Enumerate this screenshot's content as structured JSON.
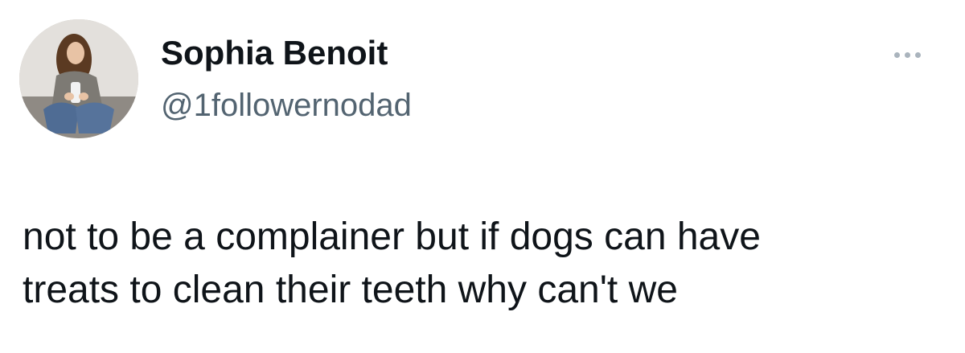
{
  "author": {
    "display_name": "Sophia Benoit",
    "handle": "@1followernodad"
  },
  "menu_icon": "more-horizontal-icon",
  "tweet": {
    "text": "not to be a complainer but if dogs can have\ntreats to clean their teeth why can't we"
  }
}
